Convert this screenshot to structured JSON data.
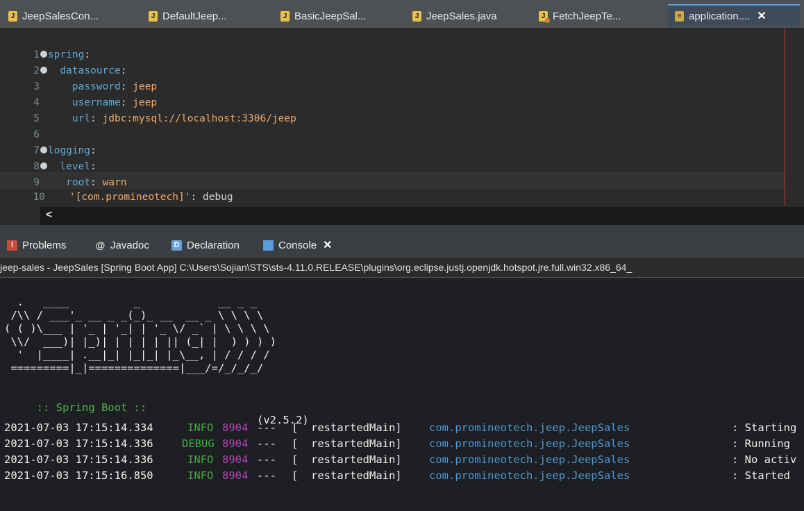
{
  "editor_tabs": [
    {
      "label": "JeepSalesCon...",
      "icon": "java-file-icon"
    },
    {
      "label": "DefaultJeep...",
      "icon": "java-file-icon"
    },
    {
      "label": "BasicJeepSal...",
      "icon": "java-file-icon"
    },
    {
      "label": "JeepSales.java",
      "icon": "java-file-icon"
    },
    {
      "label": "FetchJeepTe...",
      "icon": "java-test-file-icon"
    },
    {
      "label": "application....",
      "icon": "yaml-file-icon",
      "active": true,
      "close": "✕"
    }
  ],
  "editor": {
    "lines": [
      {
        "num": "1",
        "fold": true,
        "key": "spring",
        "sep": ":",
        "value": ""
      },
      {
        "num": "2",
        "fold": true,
        "key": "datasource",
        "sep": ":",
        "value": ""
      },
      {
        "num": "3",
        "fold": false,
        "key": "password",
        "sep": ":",
        "value": " jeep"
      },
      {
        "num": "4",
        "fold": false,
        "key": "username",
        "sep": ":",
        "value": " jeep"
      },
      {
        "num": "5",
        "fold": false,
        "key": "url",
        "sep": ":",
        "value": " jdbc:mysql://localhost:3306/jeep"
      },
      {
        "num": "6",
        "fold": false,
        "key": "",
        "sep": "",
        "value": ""
      },
      {
        "num": "7",
        "fold": true,
        "key": "logging",
        "sep": ":",
        "value": ""
      },
      {
        "num": "8",
        "fold": true,
        "key": "level",
        "sep": ":",
        "value": ""
      },
      {
        "num": "9",
        "fold": false,
        "key": "root",
        "sep": ":",
        "value": " warn"
      },
      {
        "num": "10",
        "fold": false,
        "key": "'[com.promineotech]'",
        "sep": ":",
        "value": " debug"
      }
    ],
    "scroll_left": "<"
  },
  "view_tabs": [
    {
      "label": "Problems"
    },
    {
      "label": "Javadoc"
    },
    {
      "label": "Declaration"
    },
    {
      "label": "Console",
      "active": true,
      "close": "✕"
    }
  ],
  "console": {
    "title": "jeep-sales - JeepSales [Spring Boot App] C:\\Users\\Sojian\\STS\\sts-4.11.0.RELEASE\\plugins\\org.eclipse.justj.openjdk.hotspot.jre.full.win32.x86_64_",
    "banner": "  .   ____          _            __ _ _\n /\\\\ / ___'_ __ _ _(_)_ __  __ _ \\ \\ \\ \\\n( ( )\\___ | '_ | '_| | '_ \\/ _` | \\ \\ \\ \\\n \\\\/  ___)| |_)| | | | | || (_| |  ) ) ) )\n  '  |____| .__|_| |_|_| |_\\__, | / / / /\n =========|_|==============|___/=/_/_/_/",
    "boot_label": " :: Spring Boot :: ",
    "boot_version": "(v2.5.2)",
    "logs": [
      {
        "time": "2021-07-03 17:15:14.334",
        "level": "INFO",
        "pid": "8904",
        "sep": "---",
        "thread": "[  restartedMain]",
        "logger": "com.promineotech.jeep.JeepSales",
        "msg": ": Starting"
      },
      {
        "time": "2021-07-03 17:15:14.336",
        "level": "DEBUG",
        "pid": "8904",
        "sep": "---",
        "thread": "[  restartedMain]",
        "logger": "com.promineotech.jeep.JeepSales",
        "msg": ": Running"
      },
      {
        "time": "2021-07-03 17:15:14.336",
        "level": "INFO",
        "pid": "8904",
        "sep": "---",
        "thread": "[  restartedMain]",
        "logger": "com.promineotech.jeep.JeepSales",
        "msg": ": No activ"
      },
      {
        "time": "2021-07-03 17:15:16.850",
        "level": "INFO",
        "pid": "8904",
        "sep": "---",
        "thread": "[  restartedMain]",
        "logger": "com.promineotech.jeep.JeepSales",
        "msg": ": Started"
      }
    ]
  }
}
